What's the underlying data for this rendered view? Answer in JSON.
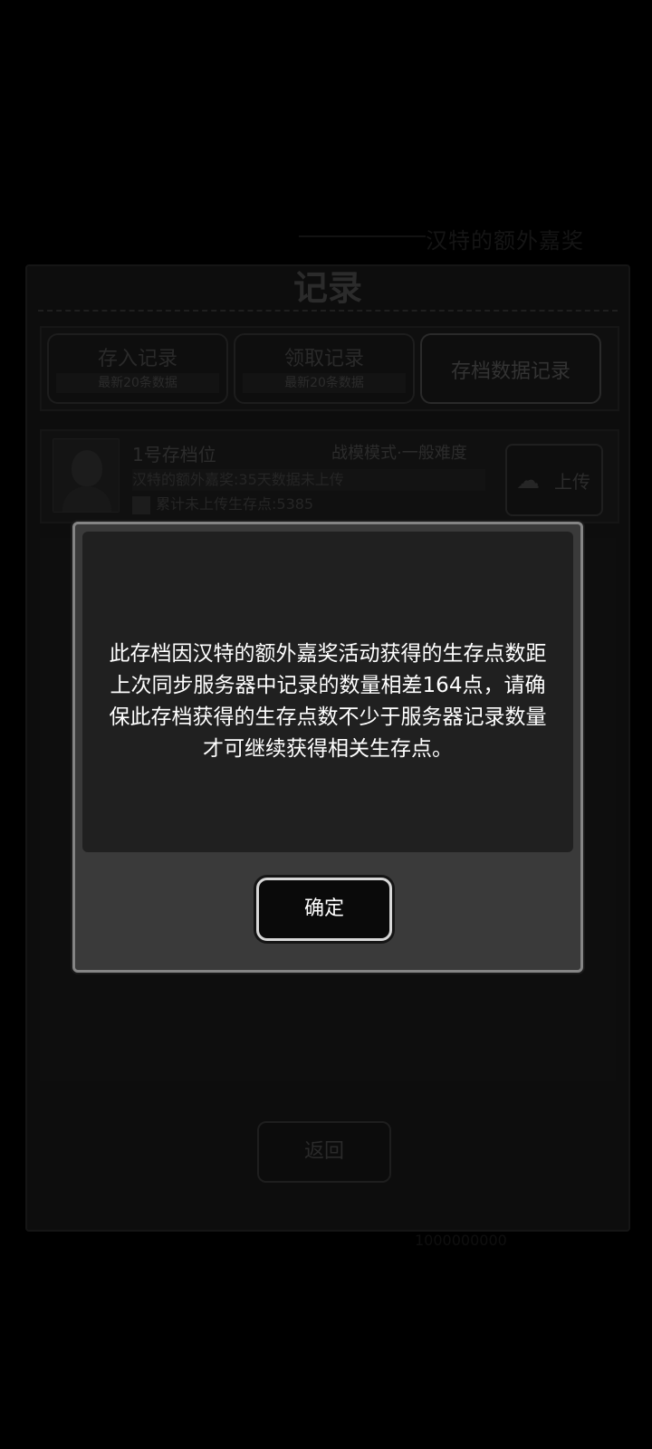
{
  "background": {
    "top_faint_text": "汉特的额外嘉奖",
    "panel_title": "记录",
    "tabs": [
      {
        "label": "存入记录",
        "sub": "最新20条数据"
      },
      {
        "label": "领取记录",
        "sub": "最新20条数据"
      },
      {
        "label": "存档数据记录"
      }
    ],
    "slot": {
      "name": "1号存档位",
      "mode": "战模模式·一般难度",
      "info1": "汉特的额外嘉奖:35天数据未上传",
      "info2": "累计未上传生存点:5385",
      "upload_label": "上传"
    },
    "back_label": "返回",
    "bottom_faint": "1000000000"
  },
  "modal": {
    "message": "此存档因汉特的额外嘉奖活动获得的生存点数距上次同步服务器中记录的数量相差164点，请确保此存档获得的生存点数不少于服务器记录数量才可继续获得相关生存点。",
    "confirm_label": "确定"
  }
}
